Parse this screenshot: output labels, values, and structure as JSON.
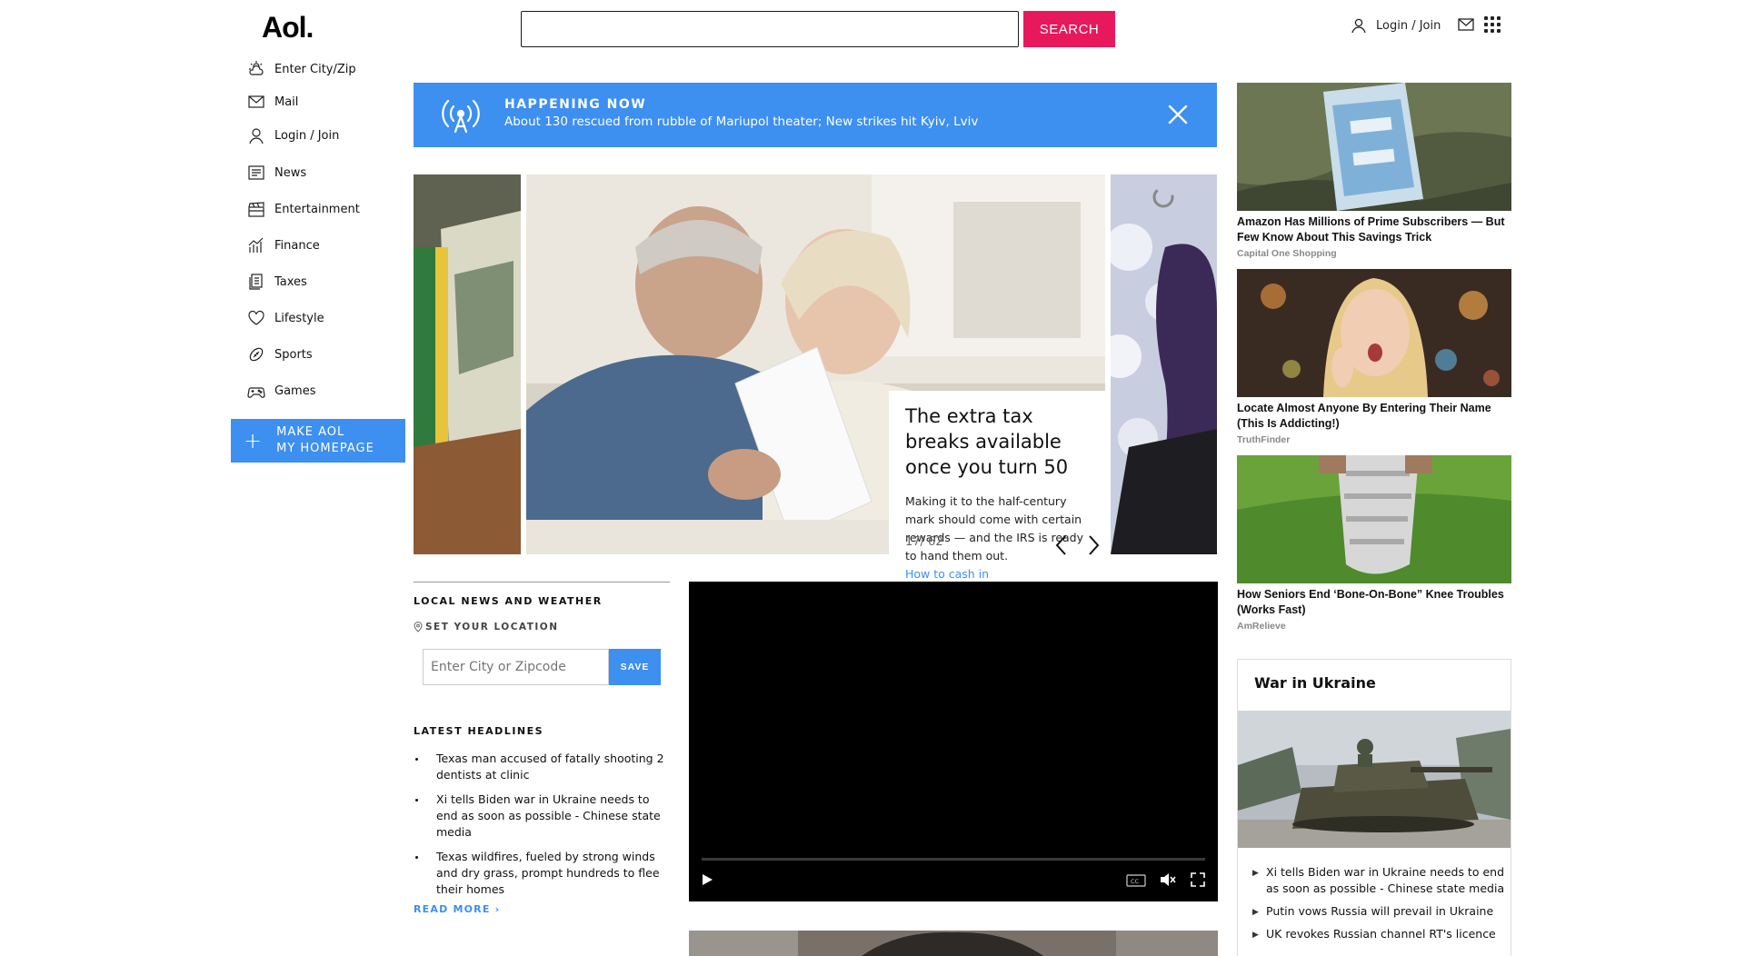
{
  "header": {
    "logo": "Aol.",
    "search_placeholder": "",
    "search_label": "SEARCH",
    "login_label": "Login / Join"
  },
  "nav": {
    "items": [
      {
        "label": "Enter City/Zip",
        "icon": "weather-icon"
      },
      {
        "label": "Mail",
        "icon": "mail-icon"
      },
      {
        "label": "Login / Join",
        "icon": "user-icon"
      },
      {
        "label": "News",
        "icon": "news-icon"
      },
      {
        "label": "Entertainment",
        "icon": "clapper-icon"
      },
      {
        "label": "Finance",
        "icon": "chart-icon"
      },
      {
        "label": "Taxes",
        "icon": "document-icon"
      },
      {
        "label": "Lifestyle",
        "icon": "heart-icon"
      },
      {
        "label": "Sports",
        "icon": "football-icon"
      },
      {
        "label": "Games",
        "icon": "gamepad-icon"
      }
    ],
    "homepage_line1": "MAKE AOL",
    "homepage_line2": "MY HOMEPAGE"
  },
  "banner": {
    "kicker": "HAPPENING NOW",
    "headline": "About 130 rescued from rubble of Mariupol theater; New strikes hit Kyiv, Lviv"
  },
  "carousel": {
    "title": "The extra tax breaks available once you turn 50",
    "description": "Making it to the half-century mark should come with certain rewards — and the IRS is ready to hand them out.",
    "cta": "How to cash in",
    "counter": "17/ 62"
  },
  "local": {
    "heading": "LOCAL NEWS AND WEATHER",
    "set_location": "SET YOUR LOCATION",
    "zip_placeholder": "Enter City or Zipcode",
    "save_label": "SAVE",
    "latest_heading": "LATEST HEADLINES",
    "headlines": [
      "Texas man accused of fatally shooting 2 dentists at clinic",
      "Xi tells Biden war in Ukraine needs to end as soon as possible - Chinese state media",
      "Texas wildfires, fueled by strong winds and dry grass, prompt hundreds to flee their homes"
    ],
    "read_more": "READ MORE ›"
  },
  "ads": [
    {
      "title": "Amazon Has Millions of Prime Subscribers — But Few Know About This Savings Trick",
      "source": "Capital One Shopping"
    },
    {
      "title": "Locate Almost Anyone By Entering Their Name (This Is Addicting!)",
      "source": "TruthFinder"
    },
    {
      "title": "How Seniors End ‘Bone-On-Bone” Knee Troubles (Works Fast)",
      "source": "AmRelieve"
    }
  ],
  "ukraine": {
    "heading": "War in Ukraine",
    "items": [
      "Xi tells Biden war in Ukraine needs to end as soon as possible - Chinese state media",
      "Putin vows Russia will prevail in Ukraine",
      "UK revokes Russian channel RT's licence"
    ]
  }
}
